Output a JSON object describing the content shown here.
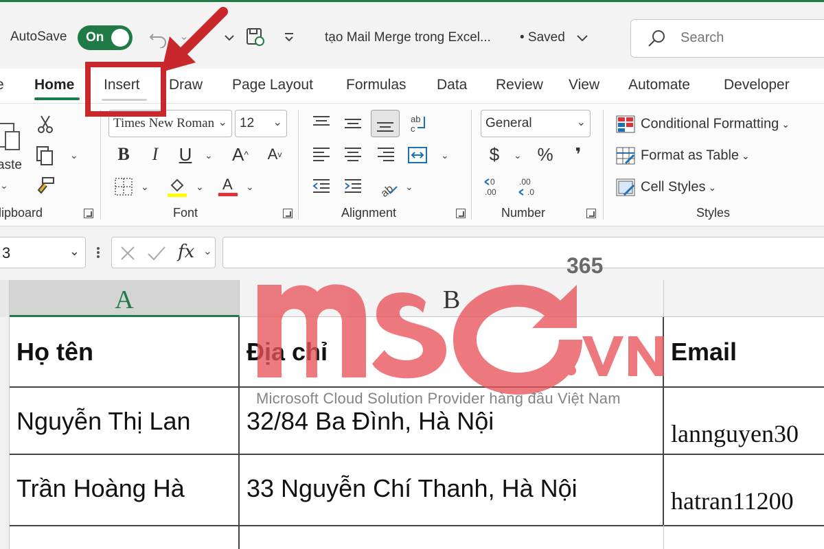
{
  "titlebar": {
    "autosave_label": "AutoSave",
    "autosave_state": "On",
    "doc_title": "tạo Mail Merge trong Excel...",
    "saved_status": "• Saved",
    "search_placeholder": "Search"
  },
  "tabs": [
    {
      "label": "e"
    },
    {
      "label": "Home"
    },
    {
      "label": "Insert"
    },
    {
      "label": "Draw"
    },
    {
      "label": "Page Layout"
    },
    {
      "label": "Formulas"
    },
    {
      "label": "Data"
    },
    {
      "label": "Review"
    },
    {
      "label": "View"
    },
    {
      "label": "Automate"
    },
    {
      "label": "Developer"
    }
  ],
  "ribbon": {
    "clipboard": {
      "paste_label": "aste",
      "group_label": "lipboard"
    },
    "font": {
      "font_name": "Times New Roman",
      "font_size": "12",
      "group_label": "Font"
    },
    "alignment": {
      "group_label": "Alignment"
    },
    "number": {
      "format": "General",
      "group_label": "Number",
      "currency_symbol": "$",
      "percent_symbol": "%",
      "comma_symbol": "❜"
    },
    "styles": {
      "conditional_formatting": "Conditional Formatting",
      "format_as_table": "Format as Table",
      "cell_styles": "Cell Styles",
      "group_label": "Styles"
    }
  },
  "formula_bar": {
    "name_box": "3",
    "fx": "fx",
    "formula": ""
  },
  "grid": {
    "columns": [
      "A",
      "B"
    ],
    "rows": [
      [
        "Họ tên",
        "Địa chỉ",
        "Email"
      ],
      [
        "Nguyễn Thị Lan",
        "32/84 Ba Đình, Hà Nội",
        "lannguyen30"
      ],
      [
        "Trần Hoàng Hà",
        "33 Nguyễn Chí Thanh, Hà Nội",
        "hatran11200"
      ]
    ]
  },
  "watermark": {
    "logo_text": "mso",
    "superscript": "365",
    "domain": ".VN",
    "tagline": "Microsoft Cloud Solution Provider hàng đầu Việt Nam"
  },
  "colors": {
    "accent": "#1f7a45",
    "annotation": "#c8282b",
    "watermark": "#e8545a"
  }
}
